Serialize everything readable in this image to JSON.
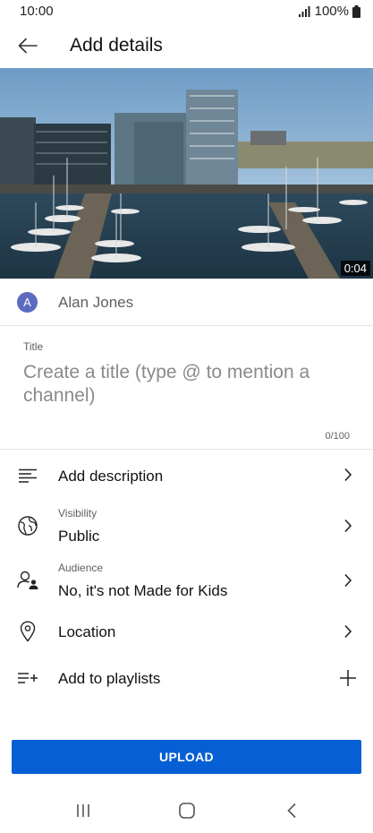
{
  "status_bar": {
    "time": "10:00",
    "battery": "100%"
  },
  "header": {
    "title": "Add details",
    "back_icon": "arrow-left-icon"
  },
  "video": {
    "duration": "0:04"
  },
  "account": {
    "avatar_letter": "A",
    "name": "Alan Jones"
  },
  "title_field": {
    "label": "Title",
    "placeholder": "Create a title (type @ to mention a channel)",
    "counter": "0/100"
  },
  "menu": {
    "description": {
      "label": "Add description",
      "icon": "text-lines-icon"
    },
    "visibility": {
      "sublabel": "Visibility",
      "value": "Public",
      "icon": "globe-icon"
    },
    "audience": {
      "sublabel": "Audience",
      "value": "No, it's not Made for Kids",
      "icon": "audience-icon"
    },
    "location": {
      "label": "Location",
      "icon": "location-pin-icon"
    },
    "playlists": {
      "label": "Add to playlists",
      "icon": "playlist-add-icon"
    }
  },
  "actions": {
    "upload_label": "UPLOAD"
  },
  "colors": {
    "accent": "#065fd4",
    "avatar": "#5c6bc0"
  }
}
